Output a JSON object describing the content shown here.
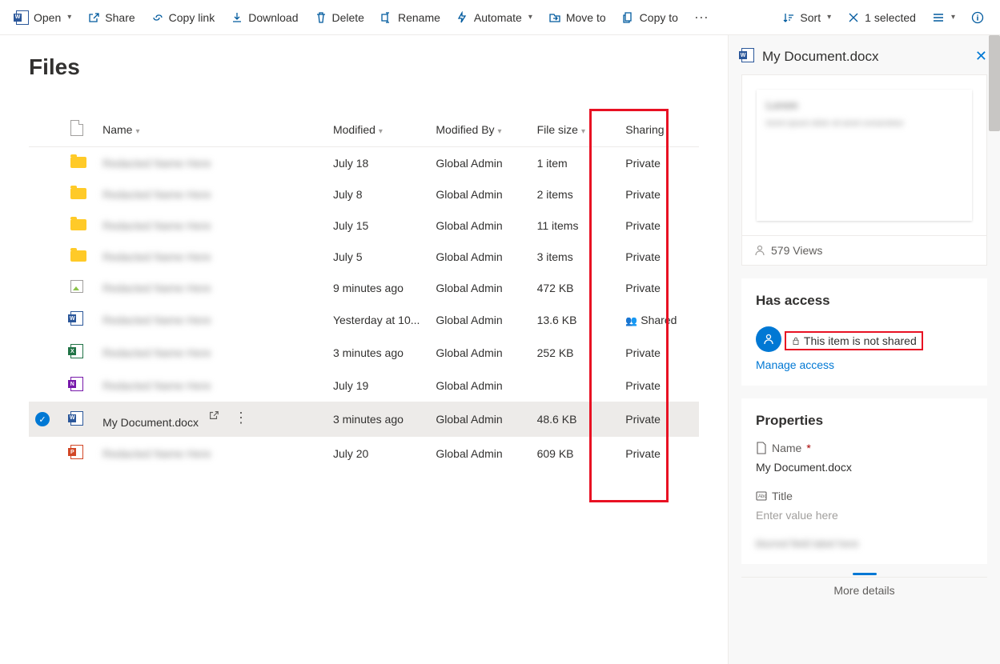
{
  "toolbar": {
    "open": "Open",
    "share": "Share",
    "copylink": "Copy link",
    "download": "Download",
    "delete": "Delete",
    "rename": "Rename",
    "automate": "Automate",
    "moveto": "Move to",
    "copyto": "Copy to",
    "sort": "Sort",
    "selected": "1 selected"
  },
  "page": {
    "title": "Files"
  },
  "columns": {
    "name": "Name",
    "modified": "Modified",
    "modifiedby": "Modified By",
    "filesize": "File size",
    "sharing": "Sharing"
  },
  "rows": [
    {
      "icon": "folder",
      "name": "blurred",
      "modified": "July 18",
      "modifiedby": "Global Admin",
      "filesize": "1 item",
      "sharing": "Private"
    },
    {
      "icon": "folder",
      "name": "blurred",
      "modified": "July 8",
      "modifiedby": "Global Admin",
      "filesize": "2 items",
      "sharing": "Private"
    },
    {
      "icon": "folder",
      "name": "blurred",
      "modified": "July 15",
      "modifiedby": "Global Admin",
      "filesize": "11 items",
      "sharing": "Private"
    },
    {
      "icon": "folder",
      "name": "blurred",
      "modified": "July 5",
      "modifiedby": "Global Admin",
      "filesize": "3 items",
      "sharing": "Private"
    },
    {
      "icon": "img",
      "name": "blurred",
      "modified": "9 minutes ago",
      "modifiedby": "Global Admin",
      "filesize": "472 KB",
      "sharing": "Private"
    },
    {
      "icon": "doc",
      "name": "blurred",
      "modified": "Yesterday at 10...",
      "modifiedby": "Global Admin",
      "filesize": "13.6 KB",
      "sharing": "Shared",
      "sharedIcon": true
    },
    {
      "icon": "xls",
      "name": "blurred",
      "modified": "3 minutes ago",
      "modifiedby": "Global Admin",
      "filesize": "252 KB",
      "sharing": "Private"
    },
    {
      "icon": "one",
      "name": "blurred",
      "modified": "July 19",
      "modifiedby": "Global Admin",
      "filesize": "",
      "sharing": "Private"
    },
    {
      "icon": "doc",
      "name": "My Document.docx",
      "modified": "3 minutes ago",
      "modifiedby": "Global Admin",
      "filesize": "48.6 KB",
      "sharing": "Private",
      "selected": true
    },
    {
      "icon": "ppt",
      "name": "blurred",
      "modified": "July 20",
      "modifiedby": "Global Admin",
      "filesize": "609 KB",
      "sharing": "Private"
    }
  ],
  "details": {
    "title": "My Document.docx",
    "views": "579 Views",
    "access": {
      "heading": "Has access",
      "notshared": "This item is not shared",
      "manage": "Manage access"
    },
    "properties": {
      "heading": "Properties",
      "name_label": "Name",
      "name_value": "My Document.docx",
      "title_label": "Title",
      "title_placeholder": "Enter value here"
    },
    "more": "More details"
  }
}
